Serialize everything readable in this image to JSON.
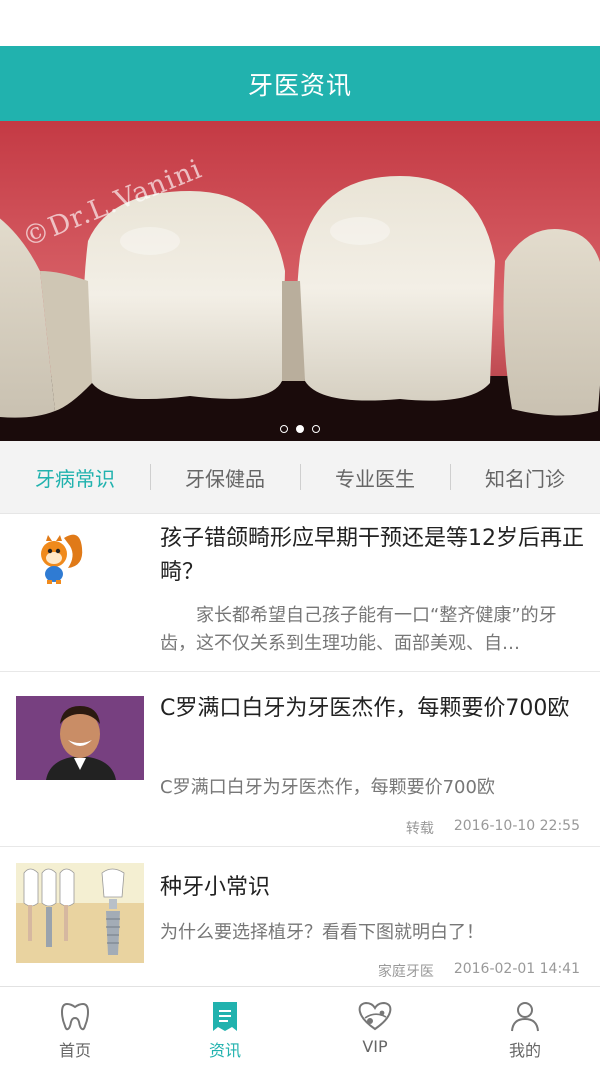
{
  "header": {
    "title": "牙医资讯"
  },
  "banner": {
    "watermark": "©Dr.L.Vanini",
    "slide_count": 3,
    "active_slide": 2
  },
  "tabs": [
    {
      "label": "牙病常识",
      "active": true
    },
    {
      "label": "牙保健品",
      "active": false
    },
    {
      "label": "专业医生",
      "active": false
    },
    {
      "label": "知名门诊",
      "active": false
    }
  ],
  "news": [
    {
      "title": "孩子错颌畸形应早期干预还是等12岁后再正畸？",
      "desc": "　　家长都希望自己孩子能有一口“整齐健康”的牙齿，这不仅关系到生理功能、面部美观、自…",
      "source": "",
      "date": "",
      "thumb": "squirrel-logo"
    },
    {
      "title": "C罗满口白牙为牙医杰作，每颗要价700欧",
      "desc": "C罗满口白牙为牙医杰作，每颗要价700欧",
      "source": "转载",
      "date": "2016-10-10 22:55",
      "thumb": "smiling-man-photo"
    },
    {
      "title": "种牙小常识",
      "desc": "为什么要选择植牙？看看下图就明白了！",
      "source": "家庭牙医",
      "date": "2016-02-01 14:41",
      "thumb": "dental-implant-diagram"
    }
  ],
  "nav": [
    {
      "label": "首页",
      "icon": "tooth-icon",
      "active": false
    },
    {
      "label": "资讯",
      "icon": "news-icon",
      "active": true
    },
    {
      "label": "VIP",
      "icon": "heart-vip-icon",
      "active": false
    },
    {
      "label": "我的",
      "icon": "user-icon",
      "active": false
    }
  ],
  "colors": {
    "accent": "#21b2ae",
    "text": "#222222",
    "muted": "#999999"
  }
}
